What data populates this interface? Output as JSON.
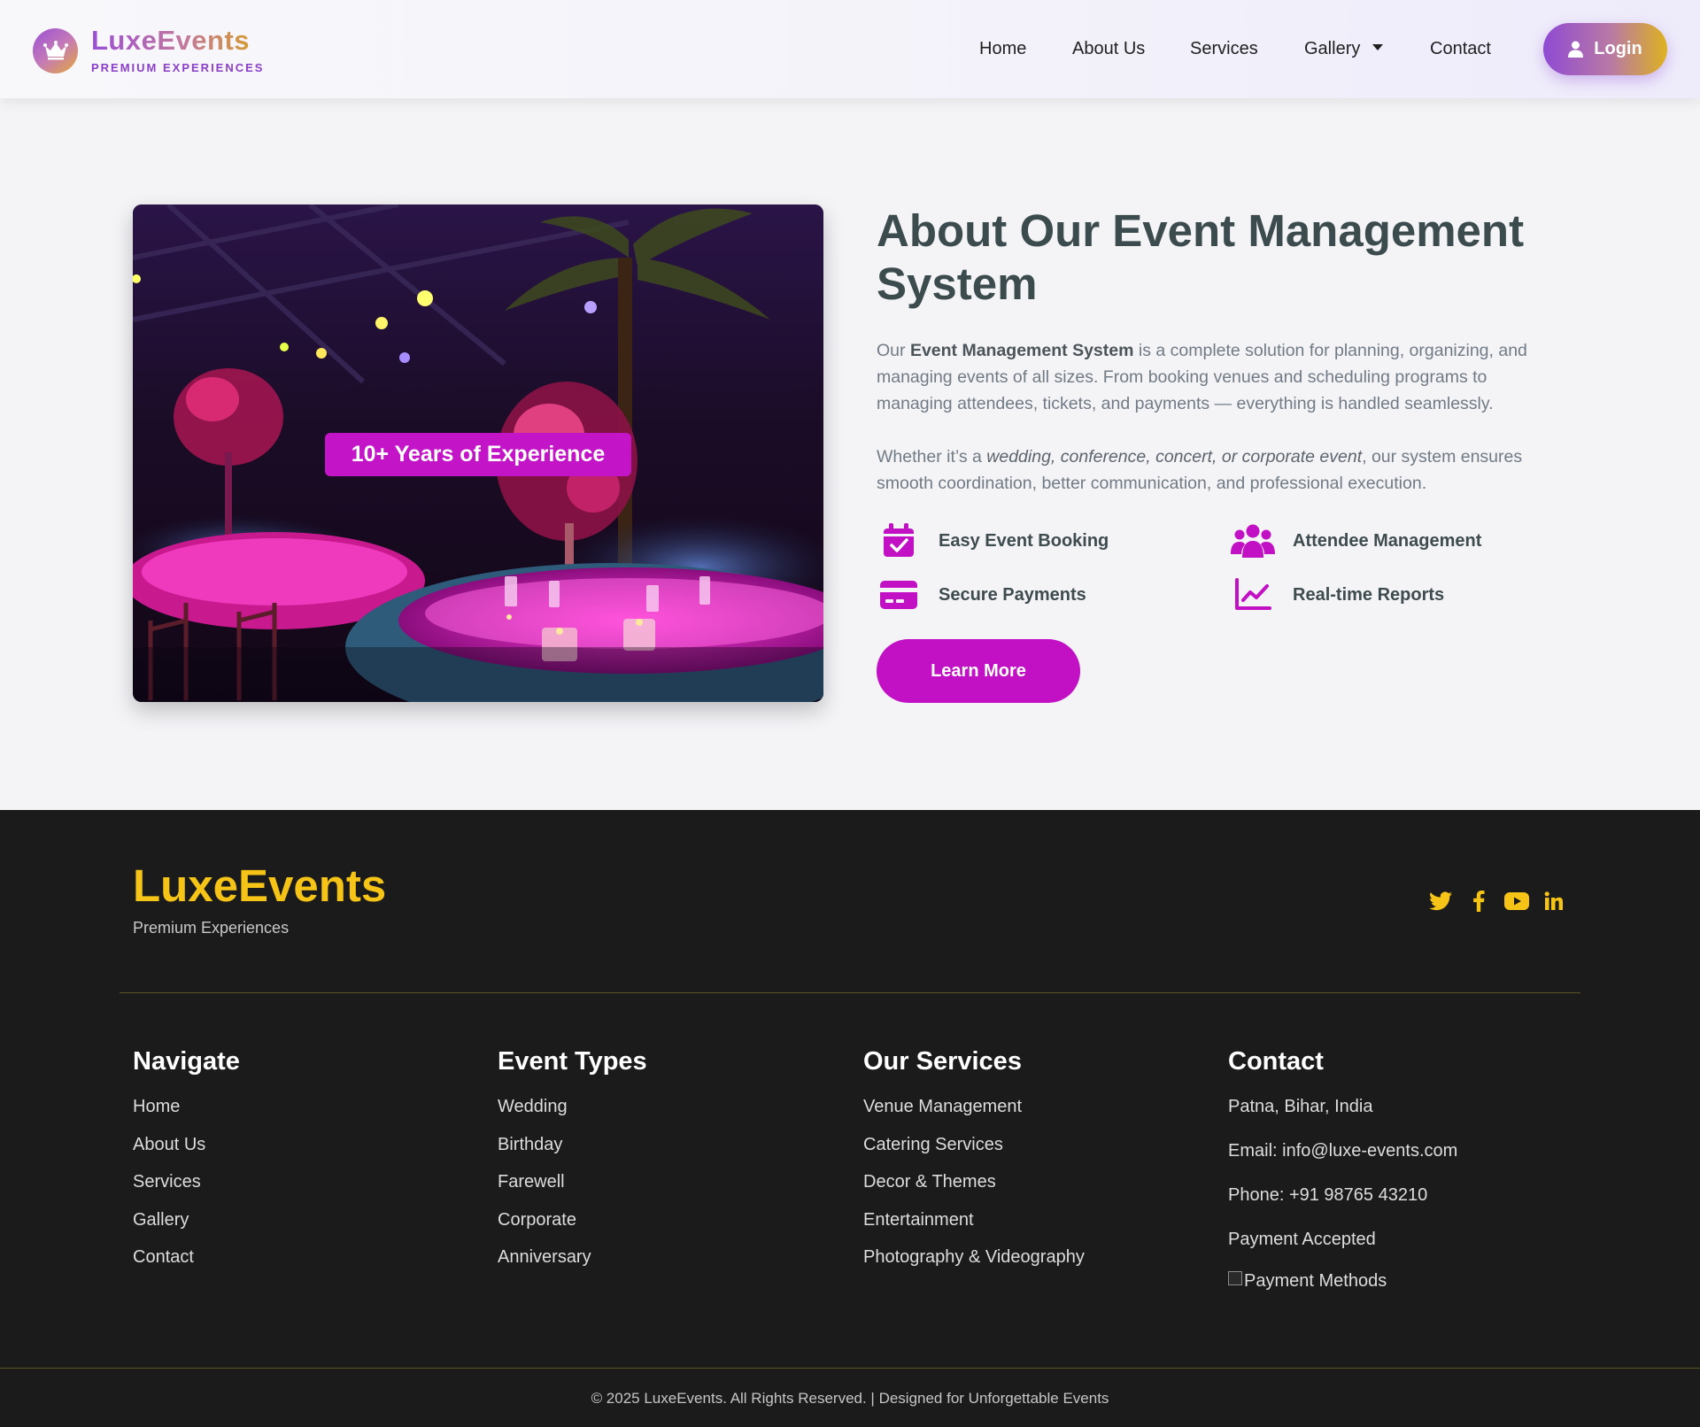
{
  "brand": {
    "name": "LuxeEvents",
    "tagline": "PREMIUM EXPERIENCES",
    "gradient_colors": [
      "#9b4fd6",
      "#d8a21f"
    ]
  },
  "nav": {
    "items": [
      "Home",
      "About Us",
      "Services",
      "Gallery",
      "Contact"
    ],
    "gallery_has_dropdown": true,
    "login_label": "Login"
  },
  "about": {
    "badge": "10+ Years of Experience",
    "title": "About Our Event Management System",
    "p1_before": "Our ",
    "p1_bold": "Event Management System",
    "p1_after": " is a complete solution for planning, organizing, and managing events of all sizes. From booking venues and scheduling programs to managing attendees, tickets, and payments — everything is handled seamlessly.",
    "p2_before": "Whether it’s a ",
    "p2_italic": "wedding, conference, concert, or corporate event",
    "p2_after": ", our system ensures smooth coordination, better communication, and professional execution.",
    "features": [
      {
        "label": "Easy Event Booking",
        "icon": "calendar-check-icon"
      },
      {
        "label": "Attendee Management",
        "icon": "users-icon"
      },
      {
        "label": "Secure Payments",
        "icon": "credit-card-icon"
      },
      {
        "label": "Real-time Reports",
        "icon": "chart-line-icon"
      }
    ],
    "cta": "Learn More",
    "accent_color": "#c210c4"
  },
  "footer": {
    "brand": "LuxeEvents",
    "tagline": "Premium Experiences",
    "accent_color": "#f6c417",
    "socials": [
      "twitter-icon",
      "facebook-icon",
      "youtube-icon",
      "linkedin-icon"
    ],
    "columns": {
      "navigate": {
        "title": "Navigate",
        "links": [
          "Home",
          "About Us",
          "Services",
          "Gallery",
          "Contact"
        ]
      },
      "event_types": {
        "title": "Event Types",
        "links": [
          "Wedding",
          "Birthday",
          "Farewell",
          "Corporate",
          "Anniversary"
        ]
      },
      "services": {
        "title": "Our Services",
        "links": [
          "Venue Management",
          "Catering Services",
          "Decor & Themes",
          "Entertainment",
          "Photography & Videography"
        ]
      },
      "contact": {
        "title": "Contact",
        "location": "Patna, Bihar, India",
        "email": "Email: info@luxe-events.com",
        "phone": "Phone: +91 98765 43210",
        "payment_label": "Payment Accepted",
        "payment_img_alt": "Payment Methods"
      }
    },
    "copyright": "© 2025 LuxeEvents. All Rights Reserved. | Designed for Unforgettable Events"
  }
}
